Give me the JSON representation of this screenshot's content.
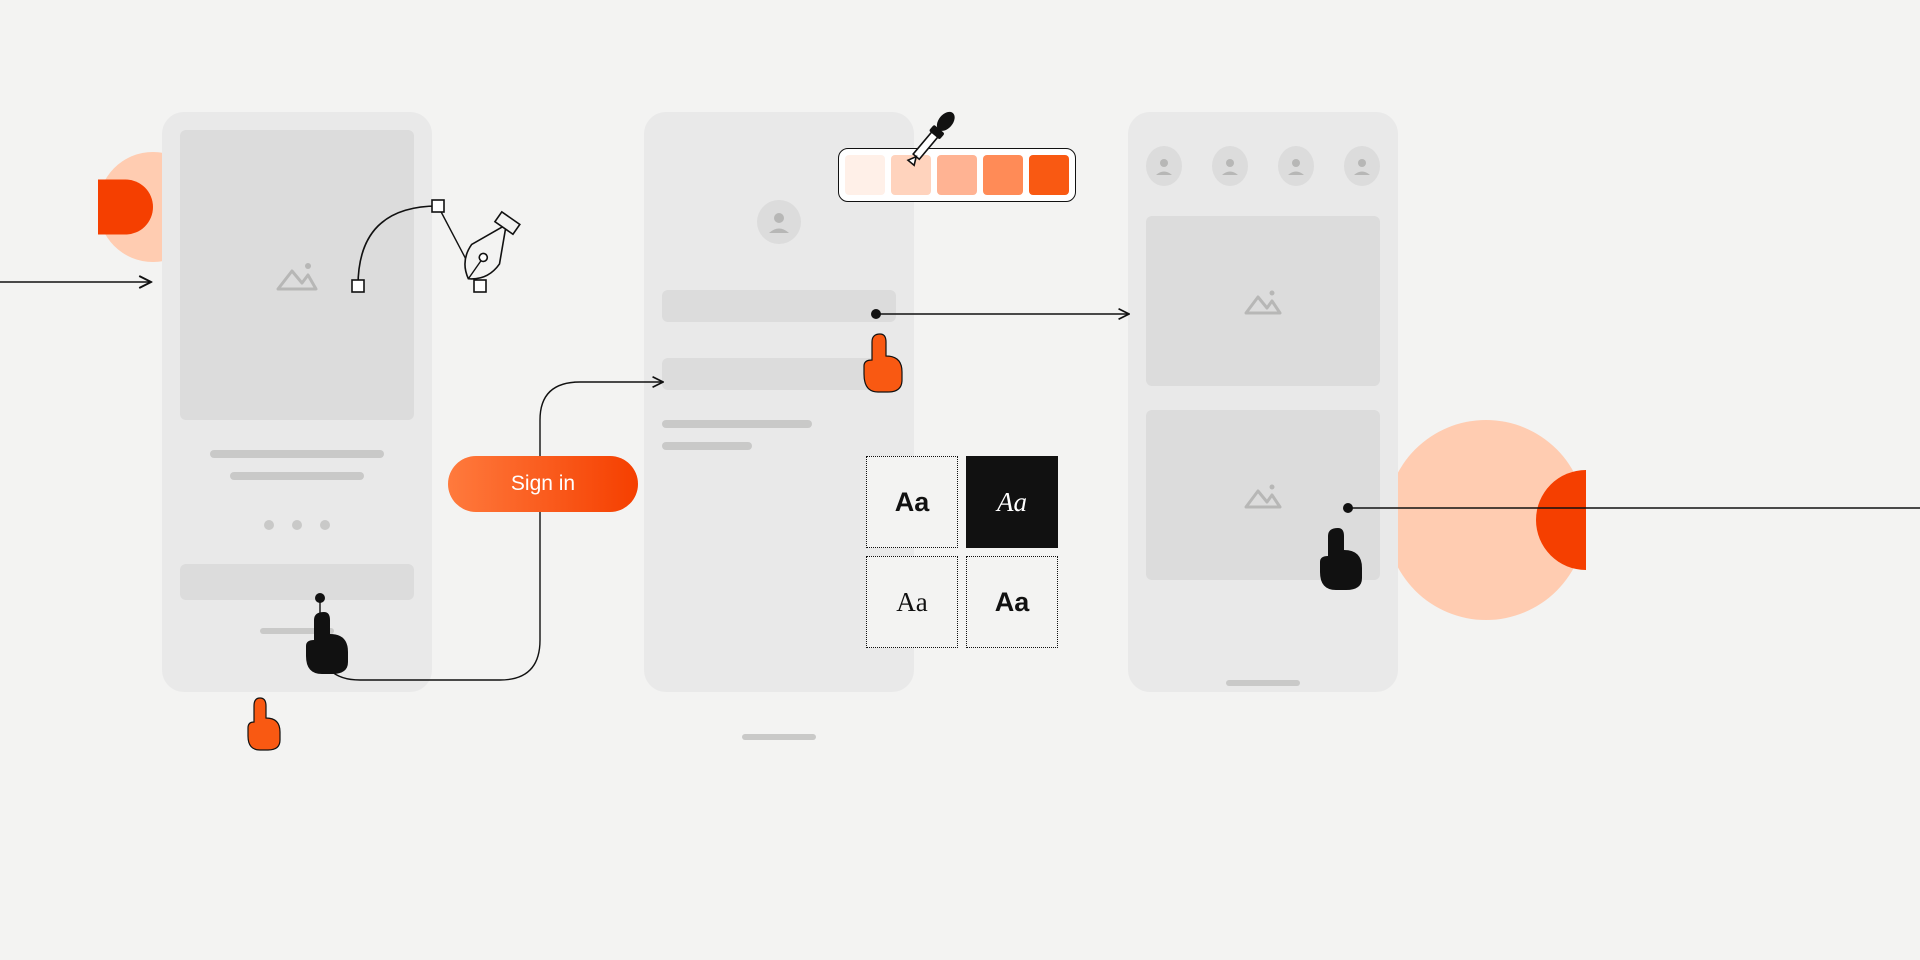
{
  "diagram": {
    "type": "design-workflow-illustration",
    "description": "Three mobile wireframe mockups connected by flow arrows, surrounded by design tool elements: pen/bezier tool, color swatches with eyedropper, font selection grid, and pointer/touch cursors.",
    "cta": {
      "label": "Sign in"
    },
    "color_palette": {
      "swatches": [
        "#fff0e8",
        "#ffd3bd",
        "#ffb393",
        "#ff8b57",
        "#f95912"
      ],
      "tool": "eyedropper"
    },
    "font_samples": {
      "specimen_text": "Aa",
      "styles": [
        "sans-serif",
        "script (selected)",
        "serif",
        "sans-serif bold"
      ]
    },
    "mockups": {
      "left": {
        "elements": [
          "hero-image",
          "text-line",
          "text-line",
          "page-dots",
          "button-bar"
        ]
      },
      "middle": {
        "elements": [
          "avatar",
          "input",
          "input",
          "text-line",
          "text-line"
        ]
      },
      "right": {
        "elements": [
          "avatar-row",
          "image-card",
          "image-card"
        ]
      }
    },
    "cursors": [
      "touch-pointer-orange",
      "touch-pointer-orange",
      "pointer-black",
      "pointer-black"
    ],
    "decorations": [
      "accent-half-sun-left",
      "accent-half-sun-right",
      "bezier-curve-with-handles",
      "pen-nib"
    ],
    "arrows": [
      "entry-arrow-from-left",
      "curved-connector left-mockup → sign-in cta → middle-mockup",
      "straight-connector middle-mockup → right-mockup",
      "exit-connector right-mockup → offscreen-right"
    ]
  }
}
